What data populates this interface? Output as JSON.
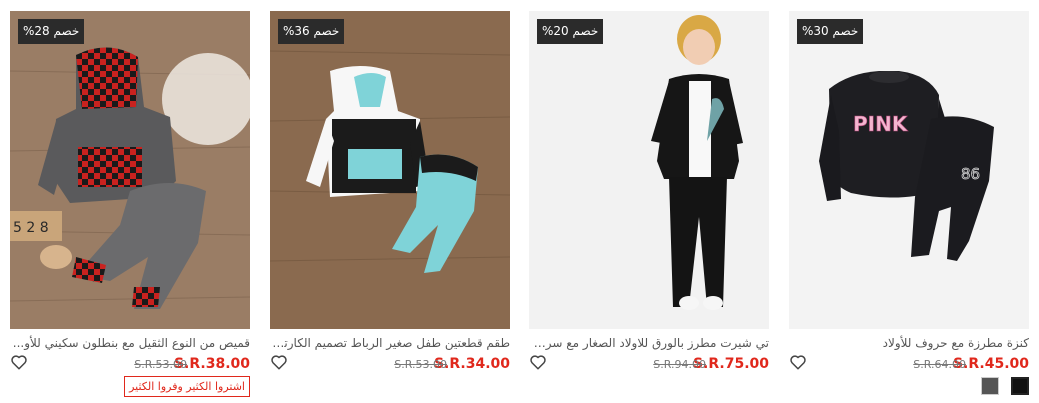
{
  "products": [
    {
      "badge": "خصم 30%",
      "title": "كنزة مطرزة مع حروف للأولاد",
      "price": "S.R.45.00",
      "old_price": "S.R.64.00",
      "print": "PINK",
      "number": "86"
    },
    {
      "badge": "خصم 20%",
      "title": "تي شيرت مطرز بالورق للاولاد الصغار مع سروال",
      "price": "S.R.75.00",
      "old_price": "S.R.94.00"
    },
    {
      "badge": "خصم 36%",
      "title": "طقم قطعتين طفل صغير الرباط تصميم الكارتو...",
      "price": "S.R.34.00",
      "old_price": "S.R.53.00"
    },
    {
      "badge": "خصم 28%",
      "title": "قميص من النوع الثقيل مع بنطلون سكيني للأو...",
      "price": "S.R.38.00",
      "old_price": "S.R.53.00",
      "promo": "اشتروا الكثير وفروا الكثير",
      "blocks": "5 2 8"
    }
  ],
  "icons": {
    "heart": "heart-outline-icon"
  },
  "colors": {
    "price": "#e0281c",
    "badge_bg": "#2b2b2b"
  }
}
